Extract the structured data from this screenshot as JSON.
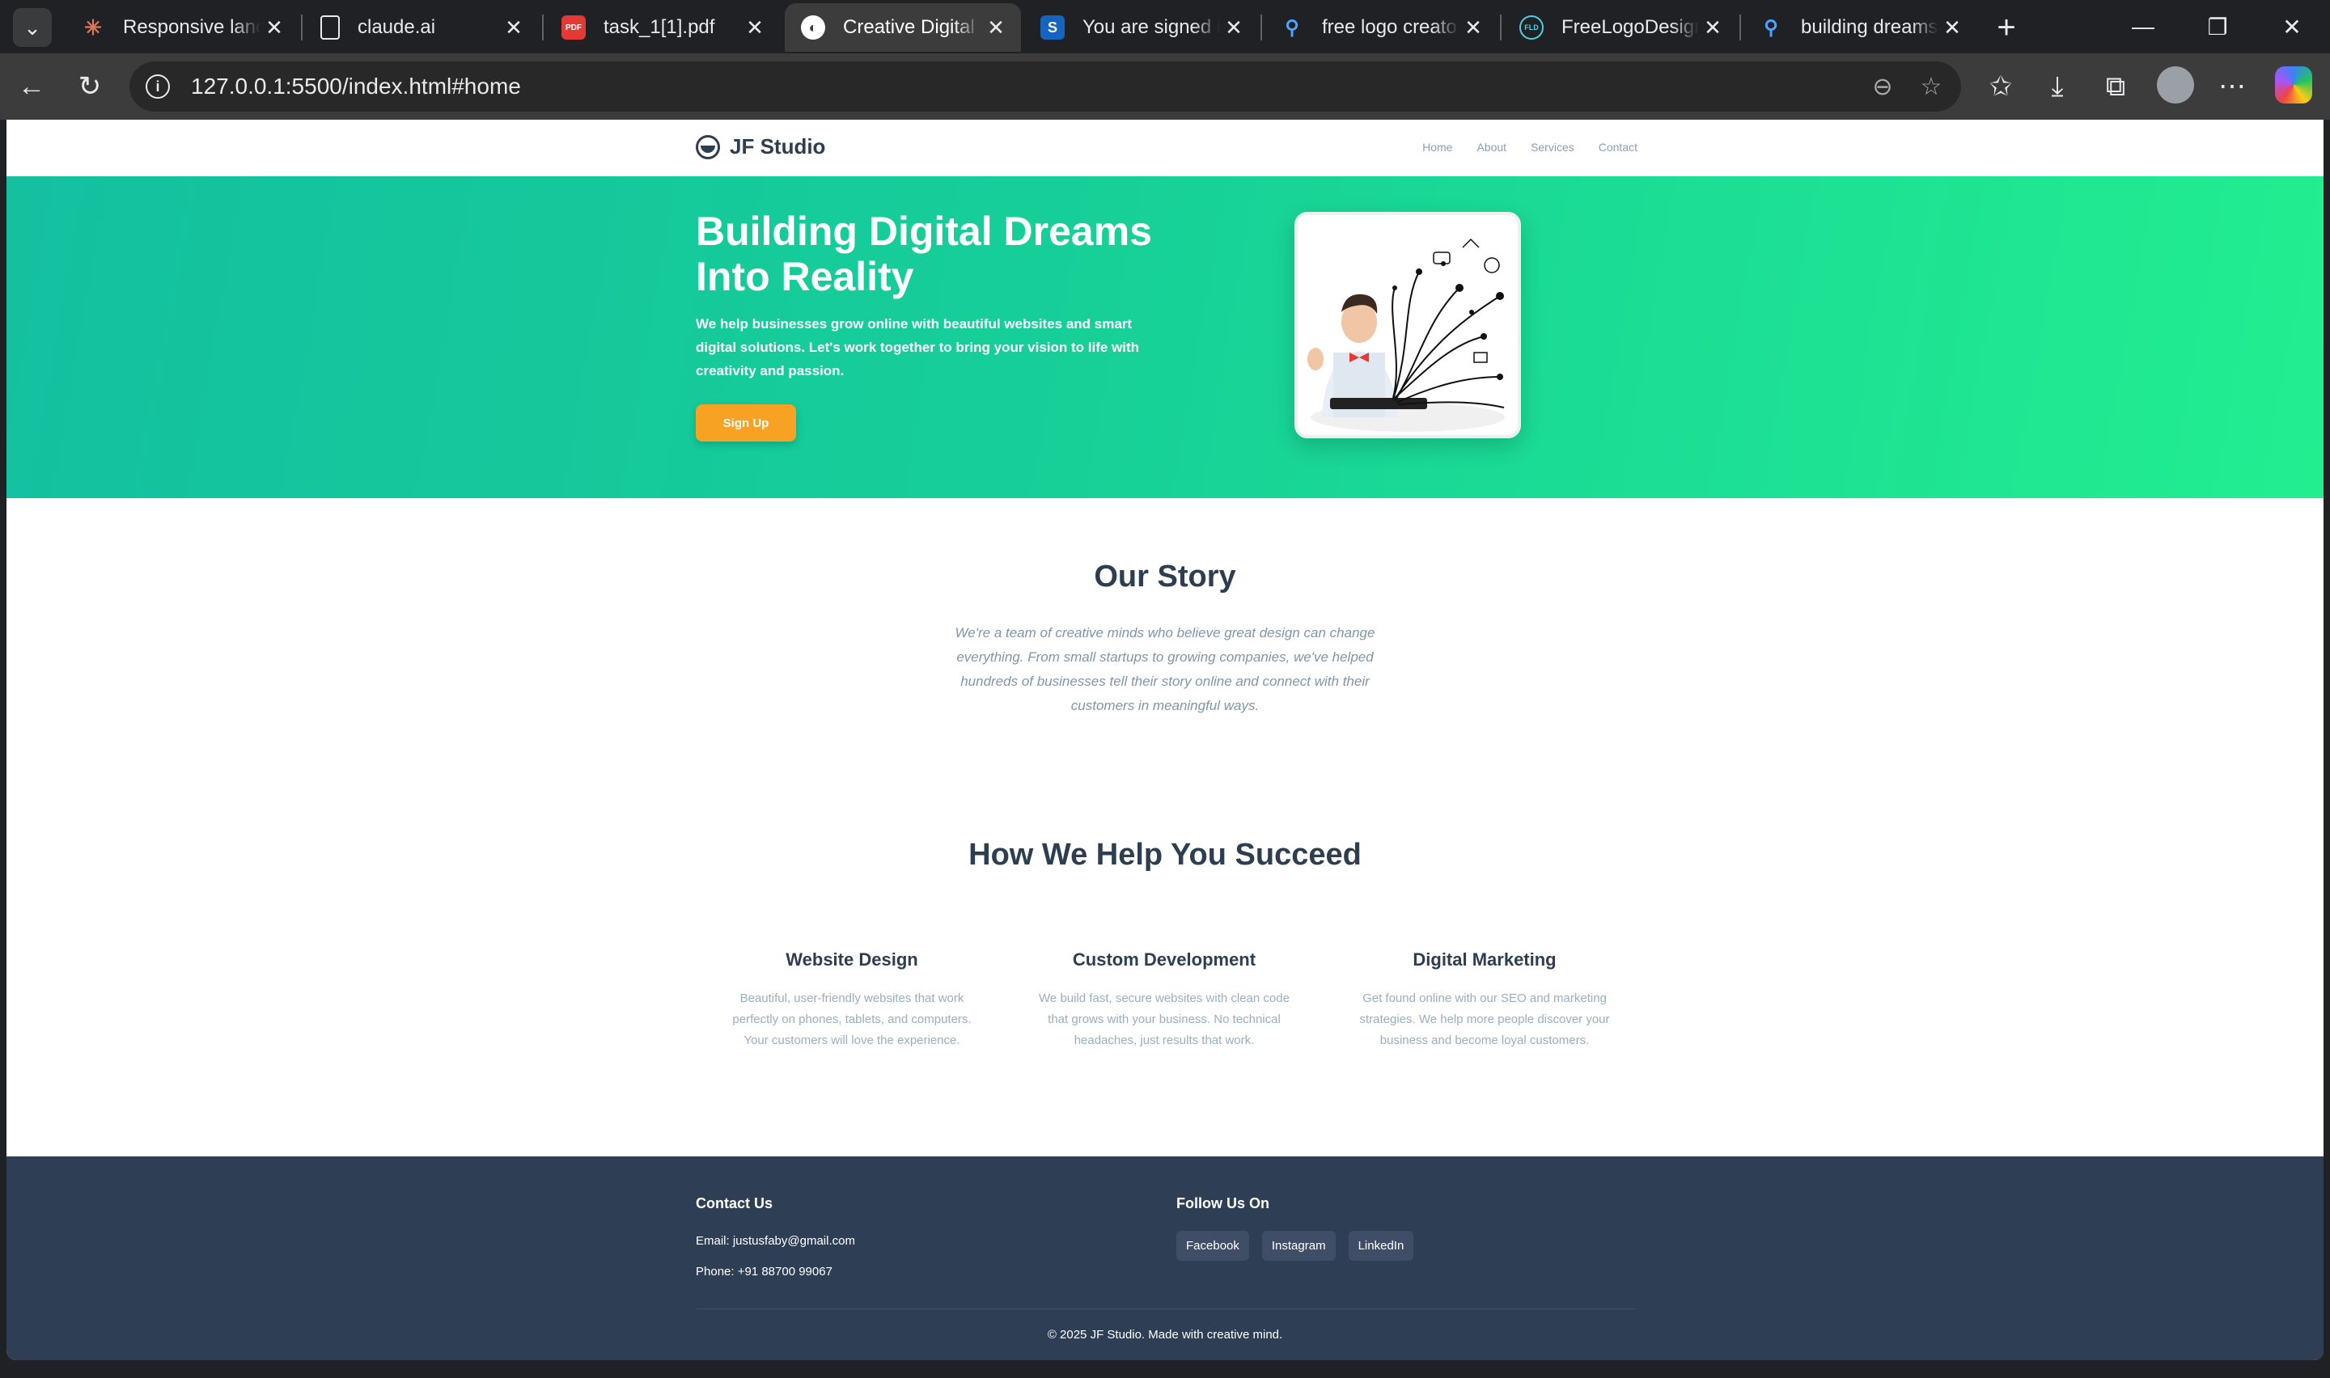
{
  "browser": {
    "tabs": [
      {
        "title": "Responsive land",
        "icon": "claude-icon",
        "active": false
      },
      {
        "title": "claude.ai",
        "icon": "document-icon",
        "active": false
      },
      {
        "title": "task_1[1].pdf",
        "icon": "pdf-icon",
        "active": false
      },
      {
        "title": "Creative Digital",
        "icon": "site-logo-icon",
        "active": true
      },
      {
        "title": "You are signed i",
        "icon": "s-app-icon",
        "active": false
      },
      {
        "title": "free logo creato",
        "icon": "search-icon",
        "active": false
      },
      {
        "title": "FreeLogoDesign",
        "icon": "fld-icon",
        "active": false
      },
      {
        "title": "building dreams",
        "icon": "search-icon",
        "active": false
      }
    ],
    "url": "127.0.0.1:5500/index.html#home",
    "accent": "#3c3c3c"
  },
  "site": {
    "brand": "JF Studio",
    "nav": [
      "Home",
      "About",
      "Services",
      "Contact"
    ],
    "hero": {
      "title": "Building Digital Dreams Into Reality",
      "text": "We help businesses grow online with beautiful websites and smart digital solutions. Let's work together to bring your vision to life with creativity and passion.",
      "cta": "Sign Up",
      "image_icon": "creative-person-illustration"
    },
    "story": {
      "title": "Our Story",
      "text": "We're a team of creative minds who believe great design can change everything. From small startups to growing companies, we've helped hundreds of businesses tell their story online and connect with their customers in meaningful ways."
    },
    "services": {
      "title": "How We Help You Succeed",
      "items": [
        {
          "title": "Website Design",
          "desc": "Beautiful, user-friendly websites that work perfectly on phones, tablets, and computers. Your customers will love the experience."
        },
        {
          "title": "Custom Development",
          "desc": "We build fast, secure websites with clean code that grows with your business. No technical headaches, just results that work."
        },
        {
          "title": "Digital Marketing",
          "desc": "Get found online with our SEO and marketing strategies. We help more people discover your business and become loyal customers."
        }
      ]
    },
    "footer": {
      "contact_title": "Contact Us",
      "email": "Email: justusfaby@gmail.com",
      "phone": "Phone: +91 88700 99067",
      "follow_title": "Follow Us On",
      "social": [
        "Facebook",
        "Instagram",
        "LinkedIn"
      ],
      "copyright": "© 2025 JF Studio. Made with creative mind."
    },
    "colors": {
      "hero_start": "#14c0a0",
      "hero_end": "#22ee90",
      "cta": "#f7a223",
      "heading": "#2c3e50",
      "footer": "#2e3e55"
    }
  }
}
